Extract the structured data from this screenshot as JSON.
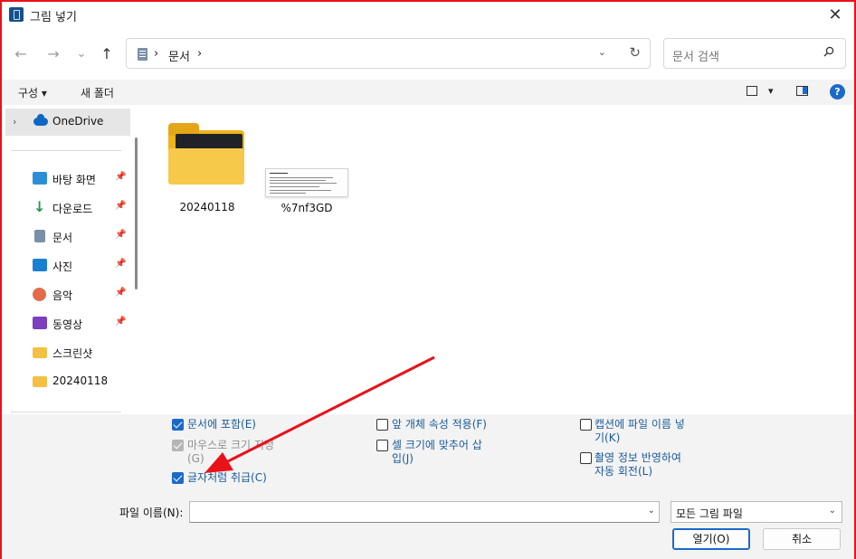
{
  "window": {
    "title": "그림 넣기",
    "close_label": "✕",
    "border_color": "#e8121a"
  },
  "nav": {
    "back": "←",
    "forward": "→",
    "recent": "⌄",
    "up": "↑"
  },
  "address": {
    "sep1": "›",
    "crumb": "문서",
    "sep2": "›",
    "dropdown": "⌄",
    "refresh": "↻"
  },
  "search": {
    "placeholder": "문서 검색"
  },
  "toolbar": {
    "organize": "구성 ▾",
    "new_folder": "새 폴더",
    "view_dd": "▾",
    "help": "?"
  },
  "sidebar": {
    "onedrive": {
      "chevron": "›",
      "label": "OneDrive"
    },
    "items": [
      {
        "label": "바탕 화면",
        "icon": "desktop-icon",
        "pin": "📌"
      },
      {
        "label": "다운로드",
        "icon": "download-icon",
        "pin": "📌"
      },
      {
        "label": "문서",
        "icon": "documents-icon",
        "pin": "📌"
      },
      {
        "label": "사진",
        "icon": "pictures-icon",
        "pin": "📌"
      },
      {
        "label": "음악",
        "icon": "music-icon",
        "pin": "📌"
      },
      {
        "label": "동영상",
        "icon": "videos-icon",
        "pin": "📌"
      },
      {
        "label": "스크린샷",
        "icon": "folder-icon",
        "pin": ""
      },
      {
        "label": "20240118",
        "icon": "folder-icon",
        "pin": ""
      }
    ]
  },
  "files": [
    {
      "name": "20240118",
      "type": "folder"
    },
    {
      "name": "%7nf3GD",
      "type": "image"
    }
  ],
  "options": {
    "include_in_doc": "문서에 포함(E)",
    "mouse_size_1": "마우스로 크기 지정",
    "mouse_size_2": "(G)",
    "treat_as_char": "글자처럼 취급(C)",
    "bring_front": "앞 개체 속성 적용(F)",
    "fit_cell_1": "셀 크기에 맞추어 삽",
    "fit_cell_2": "입(J)",
    "caption_1": "캡션에 파일 이름 넣",
    "caption_2": "기(K)",
    "rotate_1": "촬영 정보 반영하여",
    "rotate_2": "자동 회전(L)"
  },
  "bottom": {
    "filename_label": "파일 이름(N):",
    "filename_value": "",
    "filetype_value": "모든 그림 파일",
    "dropdown": "⌄",
    "open": "열기(O)",
    "cancel": "취소"
  },
  "colors": {
    "accent": "#1b6ac9",
    "folder": "#f7c94a",
    "annotation_arrow": "#e8121a"
  }
}
